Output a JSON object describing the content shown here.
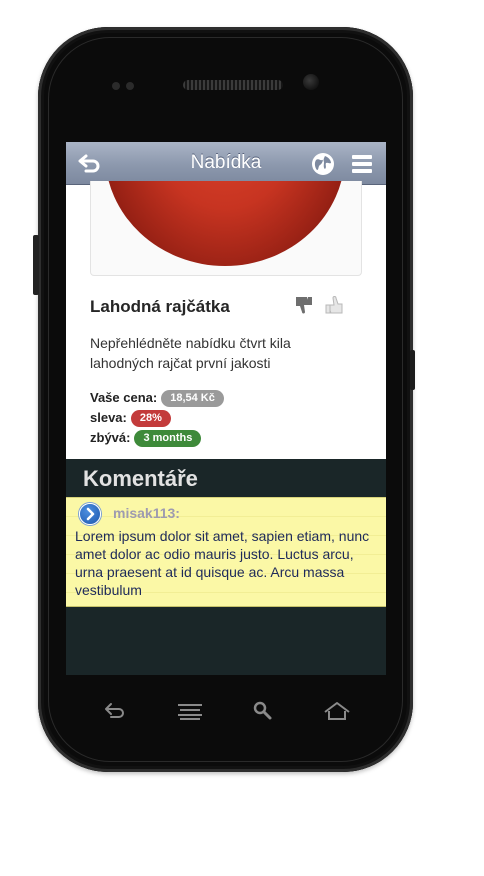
{
  "header": {
    "title": "Nabídka",
    "back_icon": "back-arrow-icon",
    "globe_icon": "globe-icon",
    "menu_icon": "list-menu-icon"
  },
  "product": {
    "title": "Lahodná rajčátka",
    "description": "Nepřehlédněte nabídku čtvrt kila lahodných rajčat první jakosti",
    "price_label": "Vaše cena:",
    "price_value": "18,54 Kč",
    "discount_label": "sleva:",
    "discount_value": "28%",
    "remaining_label": "zbývá:",
    "remaining_value": "3 months"
  },
  "comments": {
    "heading": "Komentáře",
    "items": [
      {
        "author": "misak113:",
        "text": "Lorem ipsum dolor sit amet, sapien etiam, nunc amet dolor ac odio mauris justo. Luctus arcu, urna praesent at id quisque ac. Arcu massa vestibulum"
      }
    ]
  },
  "colors": {
    "header": "#8c98ad",
    "screen_background": "#1a2628",
    "note_background": "#fbf8a6",
    "badge_price": "#9a9a9a",
    "badge_discount": "#c33b3b",
    "badge_remaining": "#3e8a3a"
  },
  "navigation_keys": [
    "back-key-icon",
    "menu-key-icon",
    "search-key-icon",
    "home-key-icon"
  ]
}
